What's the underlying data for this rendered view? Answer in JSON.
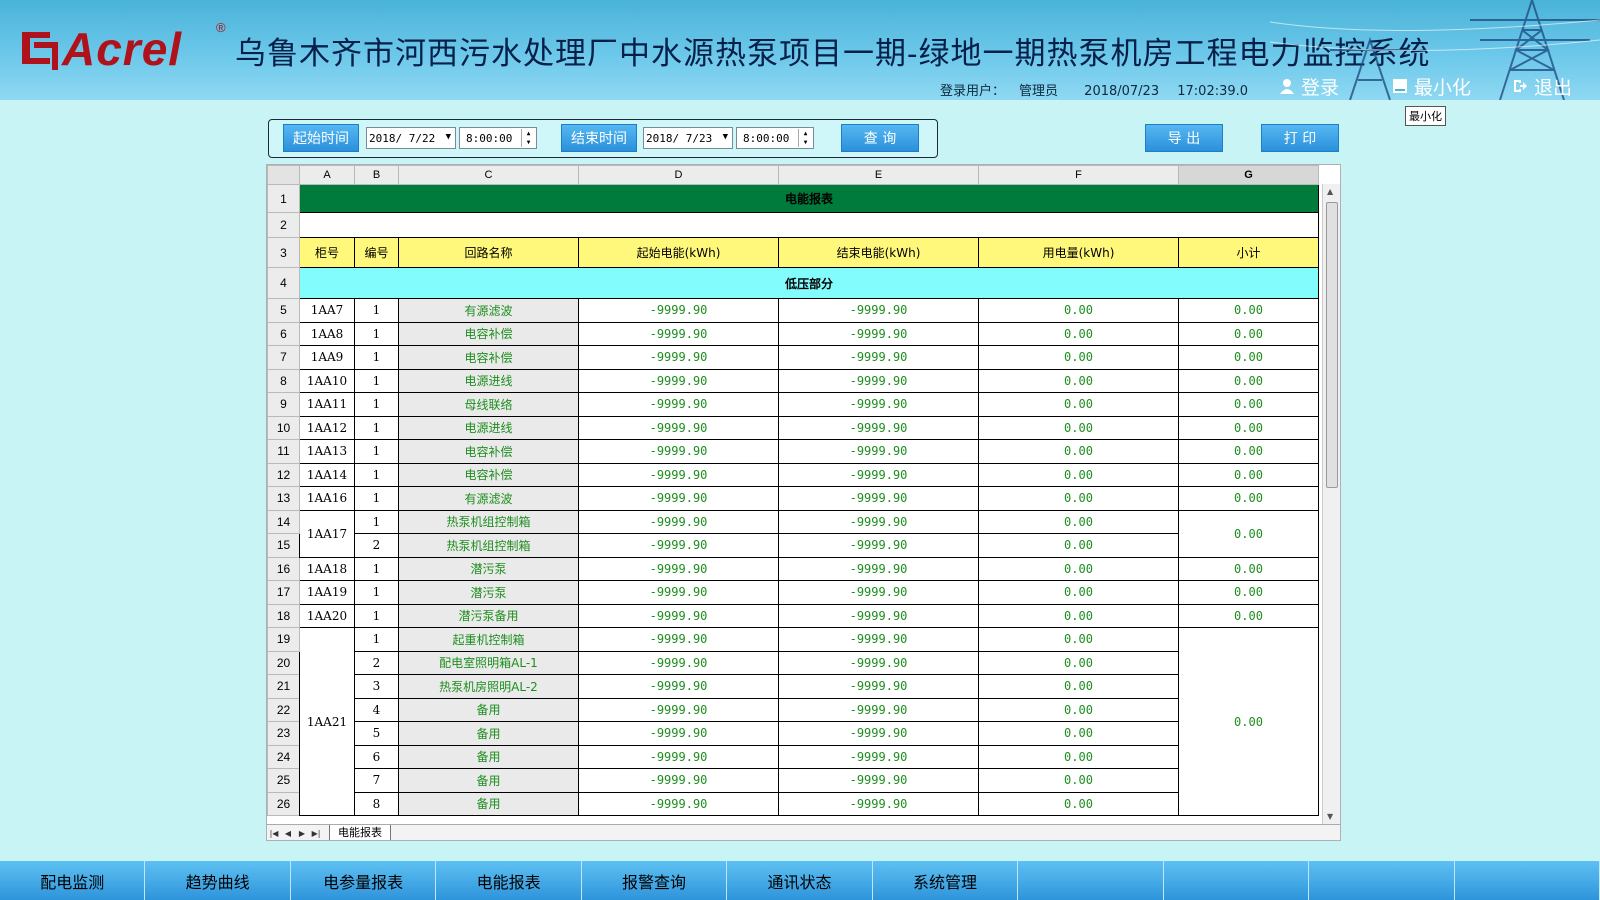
{
  "header": {
    "logo_text": "Acrel",
    "title": "乌鲁木齐市河西污水处理厂中水源热泵项目一期-绿地一期热泵机房工程电力监控系统",
    "user_label": "登录用户：",
    "user_name": "管理员",
    "date": "2018/07/23",
    "time": "17:02:39.0",
    "login_label": "登录",
    "minimize_label": "最小化",
    "exit_label": "退出",
    "tooltip": "最小化"
  },
  "query": {
    "start_label": "起始时间",
    "start_date": "2018/ 7/22",
    "start_time": "8:00:00",
    "end_label": "结束时间",
    "end_date": "2018/ 7/23",
    "end_time": "8:00:00",
    "query_label": "查 询",
    "export_label": "导 出",
    "print_label": "打 印"
  },
  "sheet": {
    "col_letters": [
      "A",
      "B",
      "C",
      "D",
      "E",
      "F",
      "G"
    ],
    "title": "电能报表",
    "headers": [
      "柜号",
      "编号",
      "回路名称",
      "起始电能(kWh)",
      "结束电能(kWh)",
      "用电量(kWh)",
      "小计"
    ],
    "section": "低压部分",
    "tab_name": "电能报表",
    "rows": [
      {
        "cab": "1AA7",
        "no": "1",
        "name": "有源滤波",
        "start": "-9999.90",
        "end": "-9999.90",
        "used": "0.00",
        "sub": "0.00"
      },
      {
        "cab": "1AA8",
        "no": "1",
        "name": "电容补偿",
        "start": "-9999.90",
        "end": "-9999.90",
        "used": "0.00",
        "sub": "0.00"
      },
      {
        "cab": "1AA9",
        "no": "1",
        "name": "电容补偿",
        "start": "-9999.90",
        "end": "-9999.90",
        "used": "0.00",
        "sub": "0.00"
      },
      {
        "cab": "1AA10",
        "no": "1",
        "name": "电源进线",
        "start": "-9999.90",
        "end": "-9999.90",
        "used": "0.00",
        "sub": "0.00"
      },
      {
        "cab": "1AA11",
        "no": "1",
        "name": "母线联络",
        "start": "-9999.90",
        "end": "-9999.90",
        "used": "0.00",
        "sub": "0.00"
      },
      {
        "cab": "1AA12",
        "no": "1",
        "name": "电源进线",
        "start": "-9999.90",
        "end": "-9999.90",
        "used": "0.00",
        "sub": "0.00"
      },
      {
        "cab": "1AA13",
        "no": "1",
        "name": "电容补偿",
        "start": "-9999.90",
        "end": "-9999.90",
        "used": "0.00",
        "sub": "0.00"
      },
      {
        "cab": "1AA14",
        "no": "1",
        "name": "电容补偿",
        "start": "-9999.90",
        "end": "-9999.90",
        "used": "0.00",
        "sub": "0.00"
      },
      {
        "cab": "1AA16",
        "no": "1",
        "name": "有源滤波",
        "start": "-9999.90",
        "end": "-9999.90",
        "used": "0.00",
        "sub": "0.00"
      },
      {
        "cab": "1AA17",
        "no": "1",
        "name": "热泵机组控制箱",
        "start": "-9999.90",
        "end": "-9999.90",
        "used": "0.00",
        "sub": "0.00"
      },
      {
        "cab": "",
        "no": "2",
        "name": "热泵机组控制箱",
        "start": "-9999.90",
        "end": "-9999.90",
        "used": "0.00",
        "sub": ""
      },
      {
        "cab": "1AA18",
        "no": "1",
        "name": "潜污泵",
        "start": "-9999.90",
        "end": "-9999.90",
        "used": "0.00",
        "sub": "0.00"
      },
      {
        "cab": "1AA19",
        "no": "1",
        "name": "潜污泵",
        "start": "-9999.90",
        "end": "-9999.90",
        "used": "0.00",
        "sub": "0.00"
      },
      {
        "cab": "1AA20",
        "no": "1",
        "name": "潜污泵备用",
        "start": "-9999.90",
        "end": "-9999.90",
        "used": "0.00",
        "sub": "0.00"
      },
      {
        "cab": "1AA21",
        "no": "1",
        "name": "起重机控制箱",
        "start": "-9999.90",
        "end": "-9999.90",
        "used": "0.00",
        "sub": "0.00"
      },
      {
        "cab": "",
        "no": "2",
        "name": "配电室照明箱AL-1",
        "start": "-9999.90",
        "end": "-9999.90",
        "used": "0.00",
        "sub": ""
      },
      {
        "cab": "",
        "no": "3",
        "name": "热泵机房照明AL-2",
        "start": "-9999.90",
        "end": "-9999.90",
        "used": "0.00",
        "sub": ""
      },
      {
        "cab": "",
        "no": "4",
        "name": "备用",
        "start": "-9999.90",
        "end": "-9999.90",
        "used": "0.00",
        "sub": ""
      },
      {
        "cab": "",
        "no": "5",
        "name": "备用",
        "start": "-9999.90",
        "end": "-9999.90",
        "used": "0.00",
        "sub": ""
      },
      {
        "cab": "",
        "no": "6",
        "name": "备用",
        "start": "-9999.90",
        "end": "-9999.90",
        "used": "0.00",
        "sub": ""
      },
      {
        "cab": "",
        "no": "7",
        "name": "备用",
        "start": "-9999.90",
        "end": "-9999.90",
        "used": "0.00",
        "sub": ""
      },
      {
        "cab": "",
        "no": "8",
        "name": "备用",
        "start": "-9999.90",
        "end": "-9999.90",
        "used": "0.00",
        "sub": ""
      }
    ]
  },
  "bottom_nav": [
    "配电监测",
    "趋势曲线",
    "电参量报表",
    "电能报表",
    "报警查询",
    "通讯状态",
    "系统管理",
    "",
    "",
    "",
    ""
  ],
  "colors": {
    "title_row": "#017b3b",
    "header_row": "#fff87a",
    "section_row": "#82fcfd",
    "value_text": "#1e8e1e",
    "logo_red": "#b0121b"
  }
}
